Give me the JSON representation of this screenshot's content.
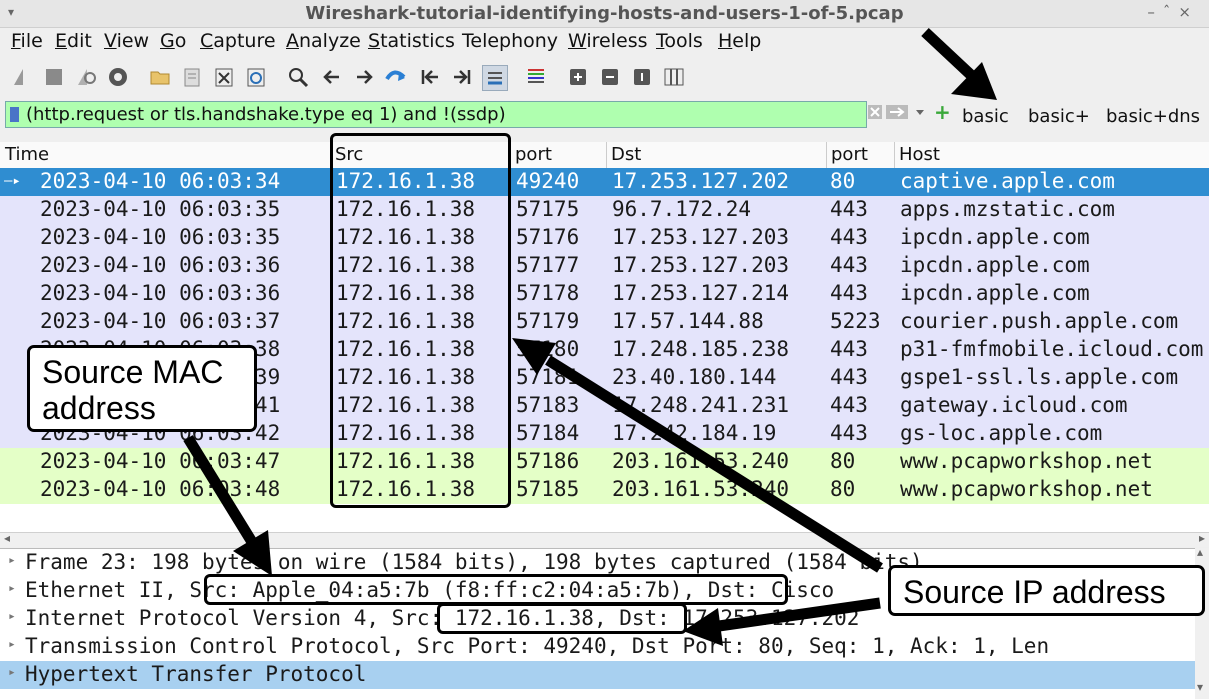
{
  "window": {
    "title": "Wireshark-tutorial-identifying-hosts-and-users-1-of-5.pcap",
    "menu_glyph": "▾",
    "controls": [
      "–",
      "ˆ",
      "×"
    ]
  },
  "menu": [
    {
      "label": "File",
      "u": "F",
      "rest": "ile"
    },
    {
      "label": "Edit",
      "u": "E",
      "rest": "dit"
    },
    {
      "label": "View",
      "u": "V",
      "rest": "iew"
    },
    {
      "label": "Go",
      "u": "G",
      "rest": "o"
    },
    {
      "label": "Capture",
      "u": "C",
      "rest": "apture"
    },
    {
      "label": "Analyze",
      "u": "A",
      "rest": "nalyze"
    },
    {
      "label": "Statistics",
      "u": "S",
      "rest": "tatistics"
    },
    {
      "label": "Telephony",
      "u": "",
      "rest": "Telephony"
    },
    {
      "label": "Wireless",
      "u": "W",
      "rest": "ireless"
    },
    {
      "label": "Tools",
      "u": "T",
      "rest": "ools"
    },
    {
      "label": "Help",
      "u": "H",
      "rest": "elp"
    }
  ],
  "filter": {
    "value": "(http.request or tls.handshake.type eq 1) and !(ssdp)",
    "buttons": [
      "basic",
      "basic+",
      "basic+dns"
    ]
  },
  "columns": [
    "Time",
    "Src",
    "port",
    "Dst",
    "port",
    "Host"
  ],
  "packets": [
    {
      "time": "2023-04-10 06:03:34",
      "src": "172.16.1.38",
      "sport": "49240",
      "dst": "17.253.127.202",
      "dport": "80",
      "host": "captive.apple.com",
      "type": "sel"
    },
    {
      "time": "2023-04-10 06:03:35",
      "src": "172.16.1.38",
      "sport": "57175",
      "dst": "96.7.172.24",
      "dport": "443",
      "host": "apps.mzstatic.com",
      "type": "tls"
    },
    {
      "time": "2023-04-10 06:03:35",
      "src": "172.16.1.38",
      "sport": "57176",
      "dst": "17.253.127.203",
      "dport": "443",
      "host": "ipcdn.apple.com",
      "type": "tls"
    },
    {
      "time": "2023-04-10 06:03:36",
      "src": "172.16.1.38",
      "sport": "57177",
      "dst": "17.253.127.203",
      "dport": "443",
      "host": "ipcdn.apple.com",
      "type": "tls"
    },
    {
      "time": "2023-04-10 06:03:36",
      "src": "172.16.1.38",
      "sport": "57178",
      "dst": "17.253.127.214",
      "dport": "443",
      "host": "ipcdn.apple.com",
      "type": "tls"
    },
    {
      "time": "2023-04-10 06:03:37",
      "src": "172.16.1.38",
      "sport": "57179",
      "dst": "17.57.144.88",
      "dport": "5223",
      "host": "courier.push.apple.com",
      "type": "tls"
    },
    {
      "time": "2023-04-10 06:03:38",
      "src": "172.16.1.38",
      "sport": "57180",
      "dst": "17.248.185.238",
      "dport": "443",
      "host": "p31-fmfmobile.icloud.com",
      "type": "tls"
    },
    {
      "time": "2023-04-10 06:03:39",
      "src": "172.16.1.38",
      "sport": "57181",
      "dst": "23.40.180.144",
      "dport": "443",
      "host": "gspe1-ssl.ls.apple.com",
      "type": "tls"
    },
    {
      "time": "2023-04-10 06:03:41",
      "src": "172.16.1.38",
      "sport": "57183",
      "dst": "17.248.241.231",
      "dport": "443",
      "host": "gateway.icloud.com",
      "type": "tls"
    },
    {
      "time": "2023-04-10 06:03:42",
      "src": "172.16.1.38",
      "sport": "57184",
      "dst": "17.242.184.19",
      "dport": "443",
      "host": "gs-loc.apple.com",
      "type": "tls"
    },
    {
      "time": "2023-04-10 06:03:47",
      "src": "172.16.1.38",
      "sport": "57186",
      "dst": "203.161.53.240",
      "dport": "80",
      "host": "www.pcapworkshop.net",
      "type": "http"
    },
    {
      "time": "2023-04-10 06:03:48",
      "src": "172.16.1.38",
      "sport": "57185",
      "dst": "203.161.53.240",
      "dport": "80",
      "host": "www.pcapworkshop.net",
      "type": "http"
    }
  ],
  "details": [
    "Frame 23: 198 bytes on wire (1584 bits), 198 bytes captured (1584 bits)",
    "Ethernet II, Src: Apple_04:a5:7b (f8:ff:c2:04:a5:7b), Dst: Cisco",
    "Internet Protocol Version 4, Src: 172.16.1.38, Dst: 17.253.127.202",
    "Transmission Control Protocol, Src Port: 49240, Dst Port: 80, Seq: 1, Ack: 1, Len",
    "Hypertext Transfer Protocol"
  ],
  "callouts": {
    "mac_line1": "Source MAC",
    "mac_line2": "address",
    "ip": "Source IP address"
  }
}
